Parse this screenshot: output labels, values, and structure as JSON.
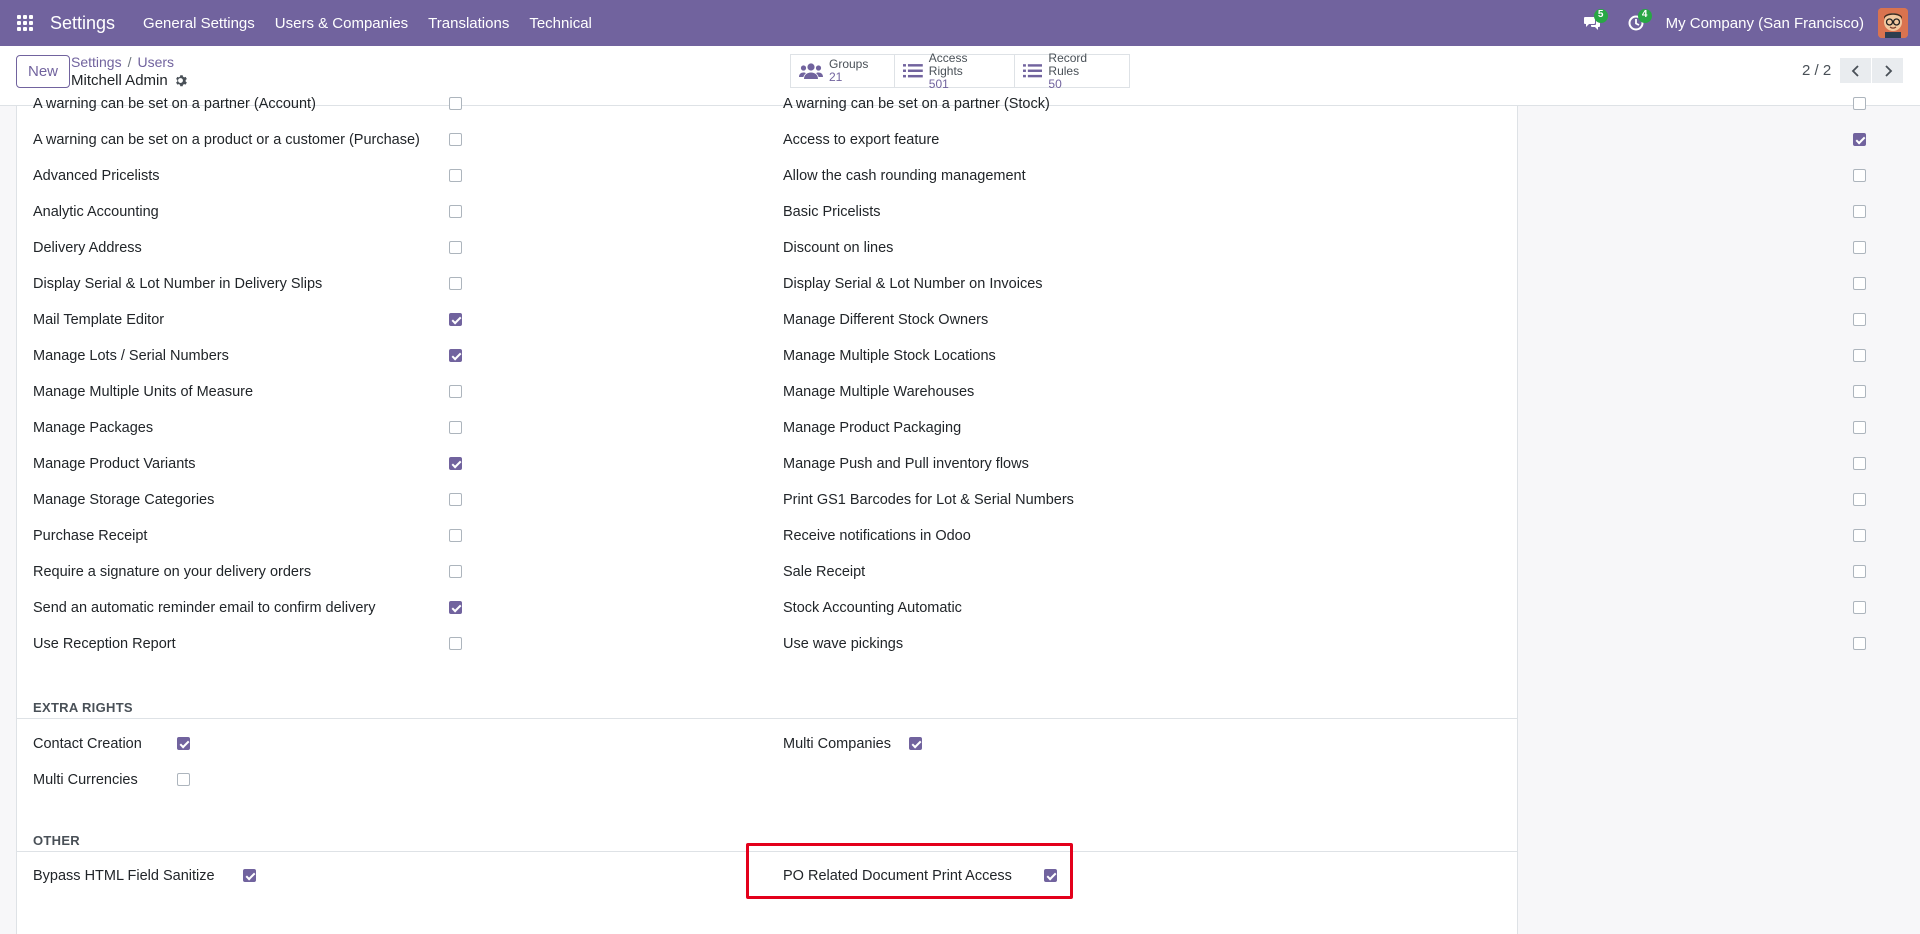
{
  "navbar": {
    "brand": "Settings",
    "menu": [
      "General Settings",
      "Users & Companies",
      "Translations",
      "Technical"
    ],
    "messages_badge": "5",
    "activity_badge": "4",
    "company": "My Company (San Francisco)"
  },
  "control": {
    "new_label": "New",
    "breadcrumb": [
      "Settings",
      "Users"
    ],
    "record_title": "Mitchell Admin",
    "smart_buttons": [
      {
        "label": "Groups",
        "value": "21"
      },
      {
        "label": "Access Rights",
        "value": "501"
      },
      {
        "label": "Record Rules",
        "value": "50"
      }
    ],
    "pager": "2 / 2"
  },
  "technical_left": [
    {
      "label": "A warning can be set on a partner (Account)",
      "checked": false
    },
    {
      "label": "A warning can be set on a product or a customer (Purchase)",
      "checked": false
    },
    {
      "label": "Advanced Pricelists",
      "checked": false
    },
    {
      "label": "Analytic Accounting",
      "checked": false
    },
    {
      "label": "Delivery Address",
      "checked": false
    },
    {
      "label": "Display Serial & Lot Number in Delivery Slips",
      "checked": false
    },
    {
      "label": "Mail Template Editor",
      "checked": true
    },
    {
      "label": "Manage Lots / Serial Numbers",
      "checked": true
    },
    {
      "label": "Manage Multiple Units of Measure",
      "checked": false
    },
    {
      "label": "Manage Packages",
      "checked": false
    },
    {
      "label": "Manage Product Variants",
      "checked": true
    },
    {
      "label": "Manage Storage Categories",
      "checked": false
    },
    {
      "label": "Purchase Receipt",
      "checked": false
    },
    {
      "label": "Require a signature on your delivery orders",
      "checked": false
    },
    {
      "label": "Send an automatic reminder email to confirm delivery",
      "checked": true
    },
    {
      "label": "Use Reception Report",
      "checked": false
    }
  ],
  "technical_right": [
    {
      "label": "A warning can be set on a partner (Stock)",
      "checked": false
    },
    {
      "label": "Access to export feature",
      "checked": true
    },
    {
      "label": "Allow the cash rounding management",
      "checked": false
    },
    {
      "label": "Basic Pricelists",
      "checked": false
    },
    {
      "label": "Discount on lines",
      "checked": false
    },
    {
      "label": "Display Serial & Lot Number on Invoices",
      "checked": false
    },
    {
      "label": "Manage Different Stock Owners",
      "checked": false
    },
    {
      "label": "Manage Multiple Stock Locations",
      "checked": false
    },
    {
      "label": "Manage Multiple Warehouses",
      "checked": false
    },
    {
      "label": "Manage Product Packaging",
      "checked": false
    },
    {
      "label": "Manage Push and Pull inventory flows",
      "checked": false
    },
    {
      "label": "Print GS1 Barcodes for Lot & Serial Numbers",
      "checked": false
    },
    {
      "label": "Receive notifications in Odoo",
      "checked": false
    },
    {
      "label": "Sale Receipt",
      "checked": false
    },
    {
      "label": "Stock Accounting Automatic",
      "checked": false
    },
    {
      "label": "Use wave pickings",
      "checked": false
    }
  ],
  "extra_rights": {
    "title": "EXTRA RIGHTS",
    "contact_creation": {
      "label": "Contact Creation",
      "checked": true
    },
    "multi_currencies": {
      "label": "Multi Currencies",
      "checked": false
    },
    "multi_companies": {
      "label": "Multi Companies",
      "checked": true
    }
  },
  "other": {
    "title": "OTHER",
    "bypass_html": {
      "label": "Bypass HTML Field Sanitize",
      "checked": true
    },
    "po_print": {
      "label": "PO Related Document Print Access",
      "checked": true
    }
  },
  "colors": {
    "brand": "#71639e",
    "highlight": "#e3001b"
  }
}
